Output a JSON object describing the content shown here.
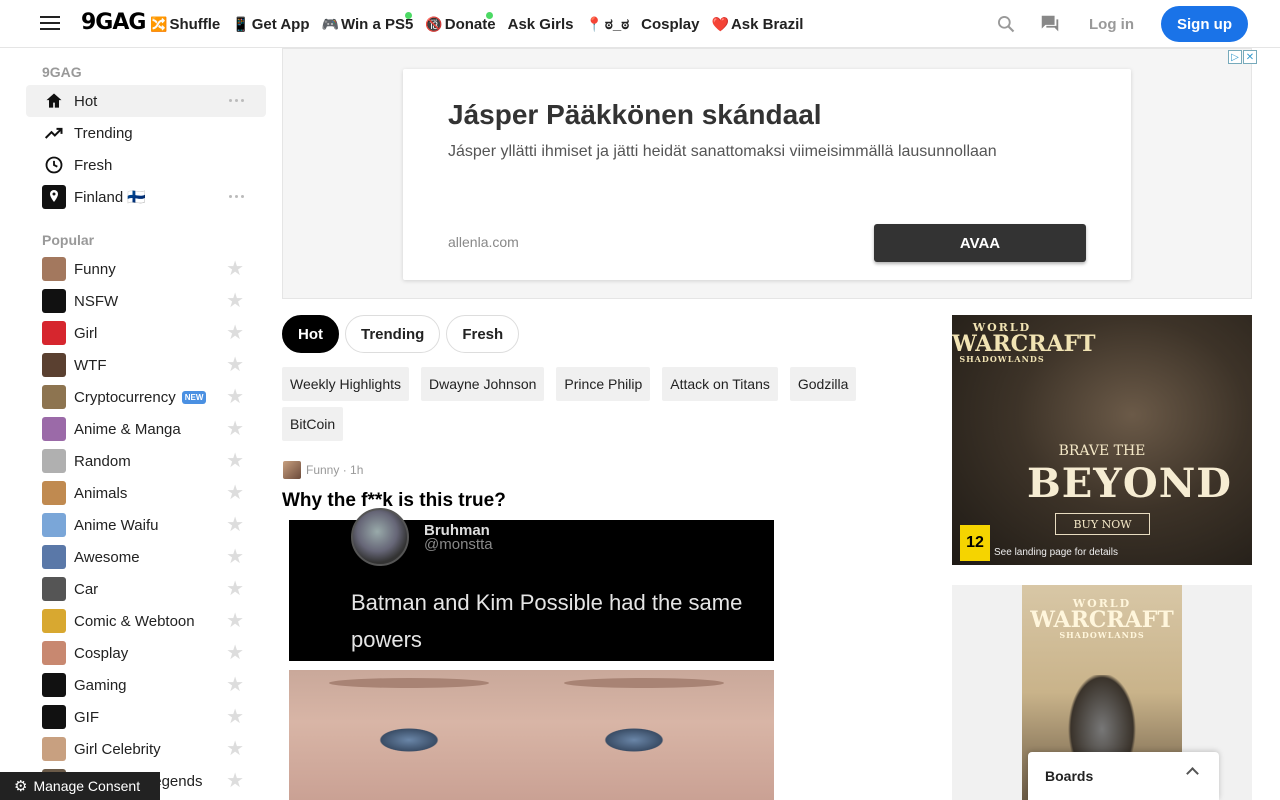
{
  "header": {
    "logo": "9GAG",
    "nav": [
      {
        "icon": "🔀",
        "label": "Shuffle",
        "dot": false
      },
      {
        "icon": "📱",
        "label": "Get App",
        "dot": false
      },
      {
        "icon": "🎮",
        "label": "Win a PS5",
        "dot": true
      },
      {
        "icon": "🔞",
        "label": "Donate",
        "dot": true
      },
      {
        "icon": "",
        "label": "Ask Girls",
        "dot": false
      },
      {
        "icon": "📍",
        "label": "ಠ_ಠ",
        "dot": false
      },
      {
        "icon": "",
        "label": "Cosplay",
        "dot": false
      },
      {
        "icon": "❤️",
        "label": "Ask Brazil",
        "dot": false
      }
    ],
    "login": "Log in",
    "signup": "Sign up"
  },
  "sidebar": {
    "section_main": "9GAG",
    "main_items": [
      {
        "label": "Hot",
        "icon": "home-icon"
      },
      {
        "label": "Trending",
        "icon": "trending-icon"
      },
      {
        "label": "Fresh",
        "icon": "clock-icon"
      },
      {
        "label": "Finland 🇫🇮",
        "icon": "location-icon"
      }
    ],
    "section_popular": "Popular",
    "popular": [
      {
        "label": "Funny",
        "color": "#a3785e"
      },
      {
        "label": "NSFW",
        "color": "#111111"
      },
      {
        "label": "Girl",
        "color": "#d6262e"
      },
      {
        "label": "WTF",
        "color": "#5a4030"
      },
      {
        "label": "Cryptocurrency",
        "color": "#8d7450",
        "badge": "NEW"
      },
      {
        "label": "Anime & Manga",
        "color": "#9b6aa8"
      },
      {
        "label": "Random",
        "color": "#b0b0b0"
      },
      {
        "label": "Animals",
        "color": "#c08a50"
      },
      {
        "label": "Anime Waifu",
        "color": "#7aa6d8"
      },
      {
        "label": "Awesome",
        "color": "#5a78a8"
      },
      {
        "label": "Car",
        "color": "#555555"
      },
      {
        "label": "Comic & Webtoon",
        "color": "#d8a830"
      },
      {
        "label": "Cosplay",
        "color": "#c88870"
      },
      {
        "label": "Gaming",
        "color": "#111111"
      },
      {
        "label": "GIF",
        "color": "#111111"
      },
      {
        "label": "Girl Celebrity",
        "color": "#c8a080"
      },
      {
        "label": "League of Legends",
        "color": "#6a5a48"
      }
    ]
  },
  "consent": "Manage Consent",
  "ad_banner": {
    "title": "Jásper Pääkkönen skándaal",
    "subtitle": "Jásper yllätti ihmiset ja jätti heidät sanattomaksi viimeisimmällä lausunnollaan",
    "domain": "allenla.com",
    "button": "AVAA"
  },
  "tabs": [
    "Hot",
    "Trending",
    "Fresh"
  ],
  "tags": [
    "Weekly Highlights",
    "Dwayne Johnson",
    "Prince Philip",
    "Attack on Titans",
    "Godzilla",
    "BitCoin"
  ],
  "post": {
    "section": "Funny",
    "time": "1h",
    "title": "Why the f**k is this true?",
    "tweet_name": "Bruhman",
    "tweet_handle": "@monstta",
    "tweet_text": "Batman and Kim Possible had the same powers"
  },
  "side_ad": {
    "logo_top": "WORLD",
    "logo_mid": "WARCRAFT",
    "logo_sub": "SHADOWLANDS",
    "brave": "BRAVE THE",
    "beyond": "BEYOND",
    "buy": "BUY NOW",
    "rating": "12",
    "landing": "See landing page for details"
  },
  "boards": "Boards"
}
